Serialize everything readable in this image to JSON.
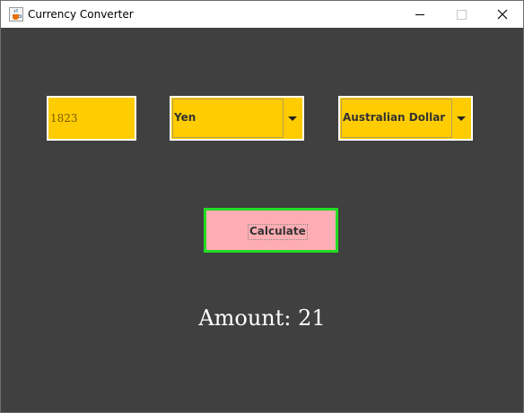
{
  "window": {
    "title": "Currency Converter"
  },
  "titlebar": {
    "icons": [
      "java-cup-icon",
      "minimize-icon",
      "maximize-icon",
      "close-icon"
    ]
  },
  "converter": {
    "amount_input": {
      "value": "1823"
    },
    "from_currency": {
      "selected": "Yen"
    },
    "to_currency": {
      "selected": "Australian Dollar"
    },
    "calculate_label": "Calculate",
    "result_text": "Amount: 21"
  },
  "colors": {
    "background": "#404040",
    "field_fill": "#ffcc00",
    "button_fill": "#ffadb4",
    "button_border": "#22dd22",
    "result_text": "#ffffff"
  }
}
